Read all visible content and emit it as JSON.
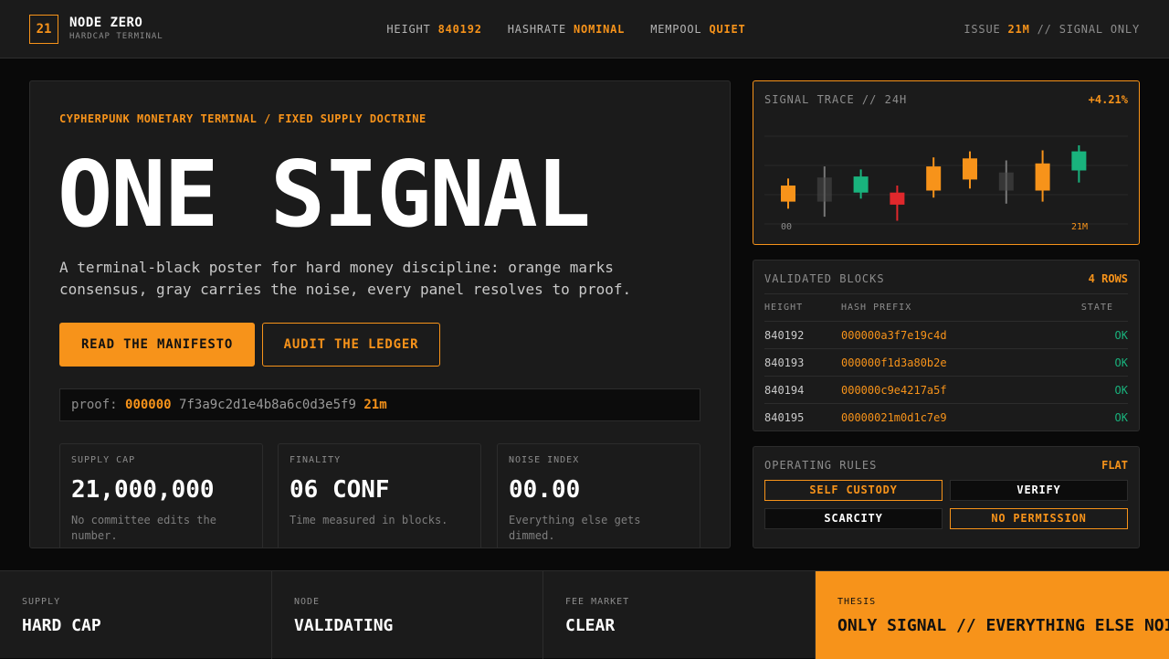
{
  "header": {
    "logo": "21",
    "brand": "NODE ZERO",
    "subtitle": "HARDCAP TERMINAL",
    "stats": [
      {
        "label": "HEIGHT",
        "value": "840192"
      },
      {
        "label": "HASHRATE",
        "value": "NOMINAL"
      },
      {
        "label": "MEMPOOL",
        "value": "QUIET"
      }
    ],
    "issue_prefix": "ISSUE",
    "issue_value": "21M",
    "issue_suffix": "// SIGNAL ONLY"
  },
  "hero": {
    "eyebrow": "CYPHERPUNK MONETARY TERMINAL / FIXED SUPPLY DOCTRINE",
    "headline": "ONE SIGNAL",
    "description": "A terminal-black poster for hard money discipline: orange marks consensus, gray carries the noise, every panel resolves to proof.",
    "primary_button": "READ THE MANIFESTO",
    "secondary_button": "AUDIT THE LEDGER",
    "proof_label": "proof:",
    "proof_zeros": "000000",
    "proof_hash": "7f3a9c2d1e4b8a6c0d3e5f9",
    "proof_tail": "21m",
    "cards": [
      {
        "label": "SUPPLY CAP",
        "value": "21,000,000",
        "note": "No committee edits the number."
      },
      {
        "label": "FINALITY",
        "value": "06 CONF",
        "note": "Time measured in blocks."
      },
      {
        "label": "NOISE INDEX",
        "value": "00.00",
        "note": "Everything else gets dimmed."
      }
    ]
  },
  "trace": {
    "title": "SIGNAL TRACE // 24H",
    "change": "+4.21%",
    "x_start": "00",
    "x_end": "21M"
  },
  "chart_data": {
    "type": "candlestick",
    "colors": {
      "orange": "#f7931a",
      "green": "#19b37d",
      "red": "#e0282c",
      "gray": "#4a4a4a"
    },
    "candles": [
      {
        "open": 24,
        "close": 40,
        "high": 47,
        "low": 17,
        "color": "orange"
      },
      {
        "open": 24,
        "close": 48,
        "high": 59,
        "low": 9,
        "color": "gray"
      },
      {
        "open": 33,
        "close": 49,
        "high": 56,
        "low": 27,
        "color": "green"
      },
      {
        "open": 21,
        "close": 33,
        "high": 40,
        "low": 5,
        "color": "red"
      },
      {
        "open": 35,
        "close": 59,
        "high": 68,
        "low": 28,
        "color": "orange"
      },
      {
        "open": 46,
        "close": 67,
        "high": 74,
        "low": 37,
        "color": "orange"
      },
      {
        "open": 35,
        "close": 53,
        "high": 65,
        "low": 22,
        "color": "gray"
      },
      {
        "open": 35,
        "close": 62,
        "high": 75,
        "low": 24,
        "color": "orange"
      },
      {
        "open": 55,
        "close": 74,
        "high": 80,
        "low": 43,
        "color": "green"
      }
    ]
  },
  "blocks": {
    "title": "VALIDATED BLOCKS",
    "count": "4 ROWS",
    "columns": [
      "HEIGHT",
      "HASH PREFIX",
      "STATE"
    ],
    "rows": [
      {
        "height": "840192",
        "hash": "000000a3f7e19c4d",
        "state": "OK"
      },
      {
        "height": "840193",
        "hash": "000000f1d3a80b2e",
        "state": "OK"
      },
      {
        "height": "840194",
        "hash": "000000c9e4217a5f",
        "state": "OK"
      },
      {
        "height": "840195",
        "hash": "00000021m0d1c7e9",
        "state": "OK"
      }
    ]
  },
  "rules": {
    "title": "OPERATING RULES",
    "tag": "FLAT",
    "items": [
      "SELF CUSTODY",
      "VERIFY",
      "SCARCITY",
      "NO PERMISSION"
    ]
  },
  "footer": [
    {
      "label": "SUPPLY",
      "value": "HARD CAP"
    },
    {
      "label": "NODE",
      "value": "VALIDATING"
    },
    {
      "label": "FEE MARKET",
      "value": "CLEAR"
    },
    {
      "label": "THESIS",
      "value": "ONLY SIGNAL // EVERYTHING ELSE NOISE"
    }
  ]
}
